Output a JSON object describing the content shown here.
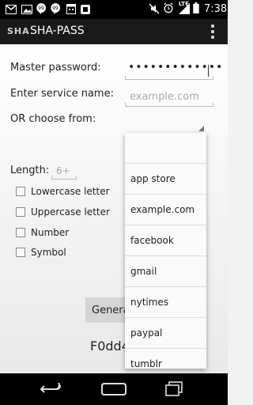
{
  "status_bar": {
    "time": "7:38",
    "network": "LTE",
    "left_icons": [
      "gmail-icon",
      "image-icon",
      "hangouts-icon",
      "hangouts-icon",
      "calendar-icon",
      "unknown-app-icon"
    ],
    "right_icons": [
      "mute-icon",
      "alarm-icon",
      "signal-icon",
      "battery-icon"
    ]
  },
  "action_bar": {
    "logo_text": "SHA",
    "title": "SHA-PASS",
    "menu_icon": "overflow-menu-icon"
  },
  "form": {
    "master_password_label": "Master password:",
    "master_password_value": "•••••••••••••",
    "service_name_label": "Enter service name:",
    "service_name_placeholder": "example.com",
    "choose_label": "OR choose from:",
    "length_label": "Length:",
    "length_placeholder": "6+",
    "options": [
      {
        "label": "Lowercase letter",
        "checked": false
      },
      {
        "label": "Uppercase letter",
        "checked": false
      },
      {
        "label": "Number",
        "checked": false
      },
      {
        "label": "Symbol",
        "checked": false
      }
    ],
    "generate_button": "Genera",
    "result": "F0dd4"
  },
  "dropdown": {
    "items": [
      "",
      "app store",
      "example.com",
      "facebook",
      "gmail",
      "nytimes",
      "paypal",
      "tumblr"
    ]
  },
  "nav_bar": {
    "icons": [
      "back-icon",
      "home-icon",
      "recent-apps-icon"
    ]
  }
}
